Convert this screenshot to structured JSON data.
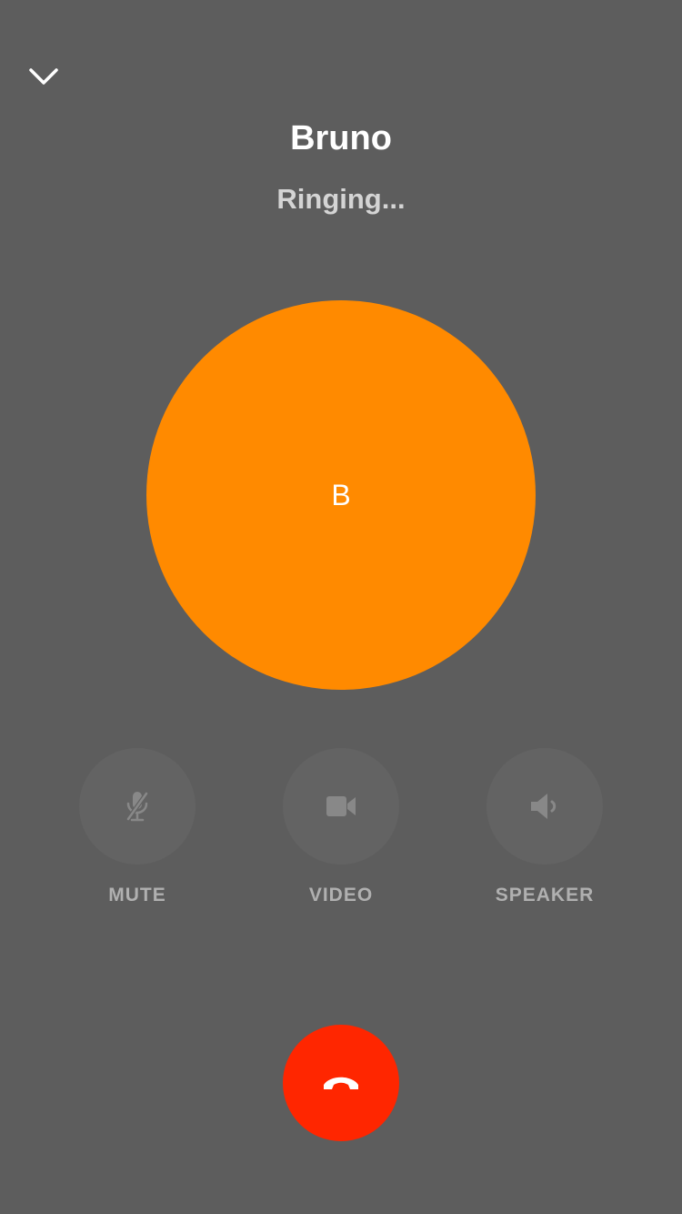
{
  "header": {
    "collapse_icon": "chevron-down-icon"
  },
  "call": {
    "name": "Bruno",
    "status": "Ringing...",
    "avatar_initial": "B",
    "avatar_color": "#ff8a00"
  },
  "controls": [
    {
      "label": "MUTE",
      "icon": "microphone-muted-icon"
    },
    {
      "label": "VIDEO",
      "icon": "video-camera-icon"
    },
    {
      "label": "SPEAKER",
      "icon": "speaker-icon"
    }
  ],
  "end_call": {
    "icon": "hang-up-phone-icon",
    "color": "#ff2600"
  },
  "colors": {
    "background": "#5d5d5d",
    "control_bg": "#636363",
    "control_icon": "#888888"
  }
}
